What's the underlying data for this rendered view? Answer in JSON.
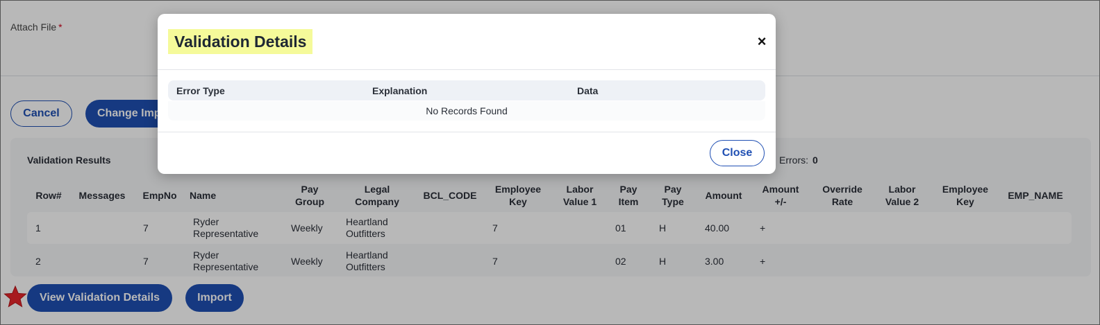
{
  "form": {
    "attach_label": "Attach File",
    "required_marker": "*"
  },
  "actions": {
    "cancel_label": "Cancel",
    "change_import_label": "Change Import"
  },
  "results": {
    "title": "Validation Results",
    "errors_label": "Errors:",
    "errors_count": "0",
    "columns": [
      "Row#",
      "Messages",
      "EmpNo",
      "Name",
      "Pay Group",
      "Legal Company",
      "BCL_CODE",
      "Employee Key",
      "Labor Value 1",
      "Pay Item",
      "Pay Type",
      "Amount",
      "Amount +/-",
      "Override Rate",
      "Labor Value 2",
      "Employee Key",
      "EMP_NAME"
    ],
    "rows": [
      {
        "row": "1",
        "messages": "",
        "empno": "7",
        "name": "Ryder Representative",
        "pay_group": "Weekly",
        "legal_company": "Heartland Outfitters",
        "bcl_code": "",
        "employee_key": "7",
        "labor_value_1": "",
        "pay_item": "01",
        "pay_type": "H",
        "amount": "40.00",
        "amount_sign": "+",
        "override_rate": "",
        "labor_value_2": "",
        "employee_key_2": "",
        "emp_name": ""
      },
      {
        "row": "2",
        "messages": "",
        "empno": "7",
        "name": "Ryder Representative",
        "pay_group": "Weekly",
        "legal_company": "Heartland Outfitters",
        "bcl_code": "",
        "employee_key": "7",
        "labor_value_1": "",
        "pay_item": "02",
        "pay_type": "H",
        "amount": "3.00",
        "amount_sign": "+",
        "override_rate": "",
        "labor_value_2": "",
        "employee_key_2": "",
        "emp_name": ""
      }
    ]
  },
  "bottom_actions": {
    "view_details_label": "View Validation Details",
    "import_label": "Import"
  },
  "modal": {
    "title": "Validation Details",
    "close_x": "×",
    "columns": [
      "Error Type",
      "Explanation",
      "Data"
    ],
    "empty_text": "No Records Found",
    "close_label": "Close"
  },
  "colors": {
    "primary": "#1f4fb3",
    "title_highlight": "#f5fa9a",
    "required": "#d0021b",
    "star": "#e8262b"
  },
  "icons": {
    "close": "close-icon",
    "star": "star-icon"
  }
}
